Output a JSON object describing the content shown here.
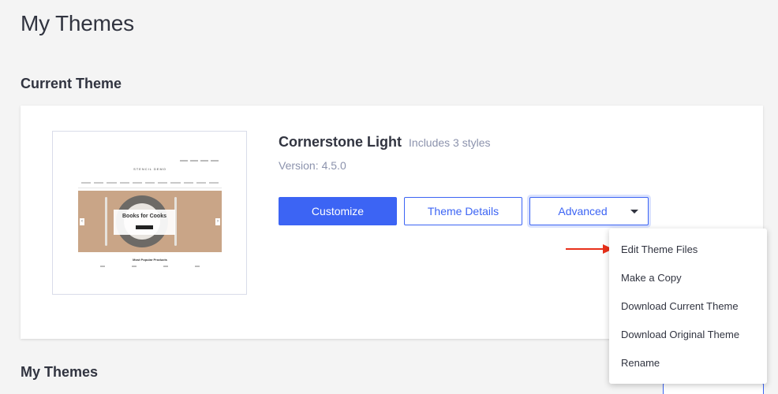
{
  "page": {
    "title": "My Themes"
  },
  "current_theme": {
    "section_title": "Current Theme",
    "name": "Cornerstone Light",
    "styles_note": "Includes 3 styles",
    "version_label": "Version:",
    "version": "4.5.0",
    "thumbnail": {
      "store_name": "STENCIL DEMO",
      "hero_title": "Books for Cooks",
      "products_heading": "Most Popular Products"
    },
    "buttons": {
      "customize": "Customize",
      "details": "Theme Details",
      "advanced": "Advanced"
    }
  },
  "advanced_menu": {
    "items": [
      {
        "label": "Edit Theme Files"
      },
      {
        "label": "Make a Copy"
      },
      {
        "label": "Download Current Theme"
      },
      {
        "label": "Download Original Theme"
      },
      {
        "label": "Rename"
      }
    ]
  },
  "my_themes": {
    "section_title": "My Themes"
  },
  "colors": {
    "primary": "#3c64f4",
    "text": "#313440",
    "muted": "#8c93ad",
    "annotation_arrow": "#e8301a",
    "background": "#f4f4f4"
  },
  "icons": {
    "advanced_caret": "caret-down-icon",
    "annotation": "arrow-right-icon"
  }
}
